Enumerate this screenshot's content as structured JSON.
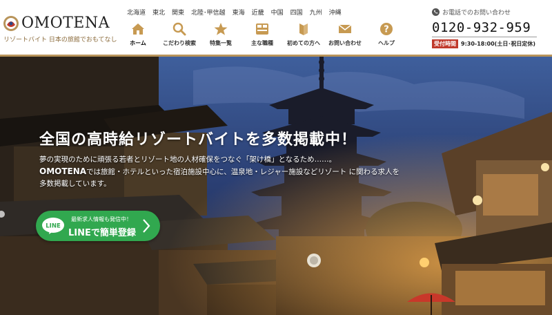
{
  "brand": {
    "name": "OMOTENA",
    "tagline": "リゾートバイト 日本の旅館でおもてなし"
  },
  "regions": [
    "北海道",
    "東北",
    "関東",
    "北陸･甲信越",
    "東海",
    "近畿",
    "中国",
    "四国",
    "九州",
    "沖縄"
  ],
  "nav": [
    {
      "label": "ホーム",
      "icon": "home-icon"
    },
    {
      "label": "こだわり検索",
      "icon": "search-icon"
    },
    {
      "label": "特集一覧",
      "icon": "star-icon"
    },
    {
      "label": "主な職種",
      "icon": "job-icon"
    },
    {
      "label": "初めての方へ",
      "icon": "beginner-icon"
    },
    {
      "label": "お問い合わせ",
      "icon": "mail-icon"
    },
    {
      "label": "ヘルプ",
      "icon": "help-icon"
    }
  ],
  "contact": {
    "label": "お電話でのお問い合わせ",
    "phone": "0120-932-959",
    "hours_badge": "受付時間",
    "hours": "9:30-18:00(土日･祝日定休)"
  },
  "hero": {
    "headline": "全国の高時給リゾートバイトを多数掲載中！",
    "desc_line1": "夢の実現のために頑張る若者とリゾート地の人材確保をつなぐ「架け橋」となるため……。",
    "desc_brand": "OMOTENA",
    "desc_rest": "では旅館・ホテルといった宿泊施設中心に、温泉地・レジャー施設などリゾート に関わる求人を多数掲載しています。",
    "line_small": "最新求人情報も発信中！",
    "line_big": "LINEで簡単登録",
    "line_logo": "LINE"
  },
  "colors": {
    "gold": "#b8945a",
    "line_green": "#31a84f",
    "badge_red": "#c0392b"
  }
}
